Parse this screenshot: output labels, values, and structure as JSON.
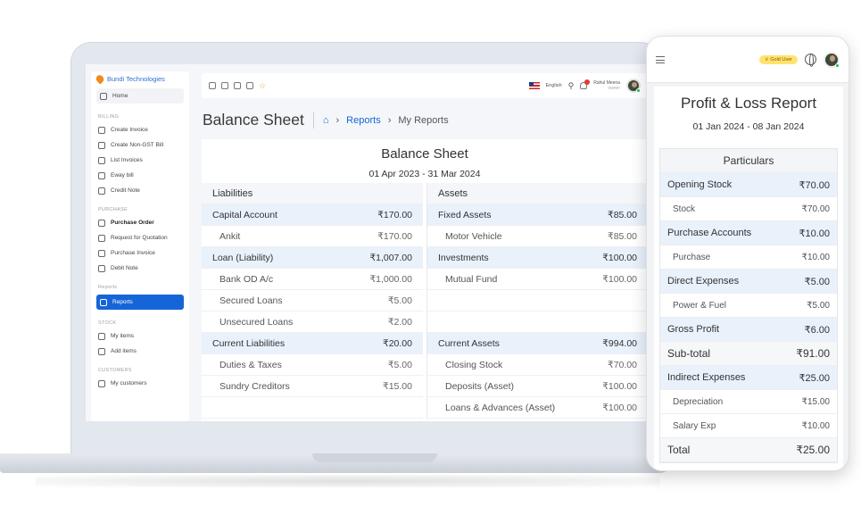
{
  "sidebar": {
    "brand": "Bundi Technologies",
    "home": "Home",
    "sections": {
      "billing": "BILLING",
      "purchase": "PURCHASE",
      "reports": "Reports",
      "stock": "STOCK",
      "customers": "CUSTOMERS"
    },
    "billing_items": [
      "Create Invoice",
      "Create Non-GST Bill",
      "List Invoices",
      "Eway bill",
      "Credit Note"
    ],
    "purchase_items": [
      "Purchase Order",
      "Request for Quotation",
      "Purchase Invoice",
      "Debit Note"
    ],
    "reports_item": "Reports",
    "stock_items": [
      "My items",
      "Add items"
    ],
    "customers_items": [
      "My customers"
    ]
  },
  "topbar": {
    "language": "English",
    "user_name": "Rahul Meena",
    "user_role": "owner"
  },
  "page": {
    "title": "Balance Sheet",
    "breadcrumb_link": "Reports",
    "breadcrumb_current": "My Reports"
  },
  "balance_sheet": {
    "title": "Balance Sheet",
    "period": "01 Apr 2023 - 31 Mar 2024",
    "liabilities_header": "Liabilities",
    "assets_header": "Assets",
    "liabilities": [
      {
        "label": "Capital Account",
        "amount": "₹170.00",
        "type": "group"
      },
      {
        "label": "Ankit",
        "amount": "₹170.00",
        "type": "item"
      },
      {
        "label": "Loan (Liability)",
        "amount": "₹1,007.00",
        "type": "group"
      },
      {
        "label": "Bank OD A/c",
        "amount": "₹1,000.00",
        "type": "item"
      },
      {
        "label": "Secured Loans",
        "amount": "₹5.00",
        "type": "item"
      },
      {
        "label": "Unsecured Loans",
        "amount": "₹2.00",
        "type": "item"
      },
      {
        "label": "Current Liabilities",
        "amount": "₹20.00",
        "type": "group"
      },
      {
        "label": "Duties & Taxes",
        "amount": "₹5.00",
        "type": "item"
      },
      {
        "label": "Sundry Creditors",
        "amount": "₹15.00",
        "type": "item"
      },
      {
        "label": "",
        "amount": "",
        "type": "blank"
      }
    ],
    "assets": [
      {
        "label": "Fixed Assets",
        "amount": "₹85.00",
        "type": "group"
      },
      {
        "label": "Motor Vehicle",
        "amount": "₹85.00",
        "type": "item"
      },
      {
        "label": "Investments",
        "amount": "₹100.00",
        "type": "group"
      },
      {
        "label": "Mutual Fund",
        "amount": "₹100.00",
        "type": "item"
      },
      {
        "label": "",
        "amount": "",
        "type": "blank"
      },
      {
        "label": "",
        "amount": "",
        "type": "blank"
      },
      {
        "label": "Current Assets",
        "amount": "₹994.00",
        "type": "group"
      },
      {
        "label": "Closing Stock",
        "amount": "₹70.00",
        "type": "item"
      },
      {
        "label": "Deposits (Asset)",
        "amount": "₹100.00",
        "type": "item"
      },
      {
        "label": "Loans & Advances (Asset)",
        "amount": "₹100.00",
        "type": "item"
      }
    ]
  },
  "phone": {
    "badge": "Gold User",
    "title": "Profit & Loss Report",
    "period": "01 Jan 2024 - 08 Jan 2024",
    "header": "Particulars",
    "rows": [
      {
        "label": "Opening Stock",
        "amount": "₹70.00",
        "type": "group"
      },
      {
        "label": "Stock",
        "amount": "₹70.00",
        "type": "item"
      },
      {
        "label": "Purchase Accounts",
        "amount": "₹10.00",
        "type": "group"
      },
      {
        "label": "Purchase",
        "amount": "₹10.00",
        "type": "item"
      },
      {
        "label": "Direct Expenses",
        "amount": "₹5.00",
        "type": "group"
      },
      {
        "label": "Power & Fuel",
        "amount": "₹5.00",
        "type": "item"
      },
      {
        "label": "Gross Profit",
        "amount": "₹6.00",
        "type": "group"
      },
      {
        "label": "Sub-total",
        "amount": "₹91.00",
        "type": "total"
      },
      {
        "label": "Indirect Expenses",
        "amount": "₹25.00",
        "type": "group"
      },
      {
        "label": "Depreciation",
        "amount": "₹15.00",
        "type": "item"
      },
      {
        "label": "Salary Exp",
        "amount": "₹10.00",
        "type": "item"
      },
      {
        "label": "Total",
        "amount": "₹25.00",
        "type": "total"
      }
    ]
  }
}
